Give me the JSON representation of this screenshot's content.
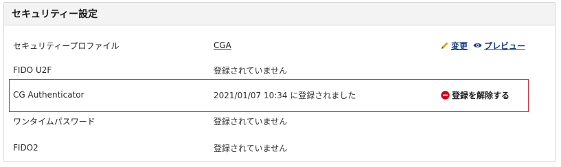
{
  "panel": {
    "title": "セキュリティー設定"
  },
  "rows": [
    {
      "label": "セキュリティープロファイル",
      "value": "CGA",
      "actions": {
        "edit_label": "変更",
        "preview_label": "プレビュー"
      }
    },
    {
      "label": "FIDO U2F",
      "value": "登録されていません"
    },
    {
      "label": "CG Authenticator",
      "value": "2021/01/07 10:34 に登録されました",
      "actions": {
        "remove_label": "登録を解除する"
      }
    },
    {
      "label": "ワンタイムパスワード",
      "value": "登録されていません"
    },
    {
      "label": "FIDO2",
      "value": "登録されていません"
    }
  ],
  "icons": {
    "edit": "pencil-icon",
    "preview": "eye-icon",
    "remove": "minus-circle-icon"
  },
  "colors": {
    "link": "#1a3f8f",
    "highlight_border": "#c8313a",
    "remove_icon": "#d0021b",
    "pencil": "#e0a21a"
  }
}
